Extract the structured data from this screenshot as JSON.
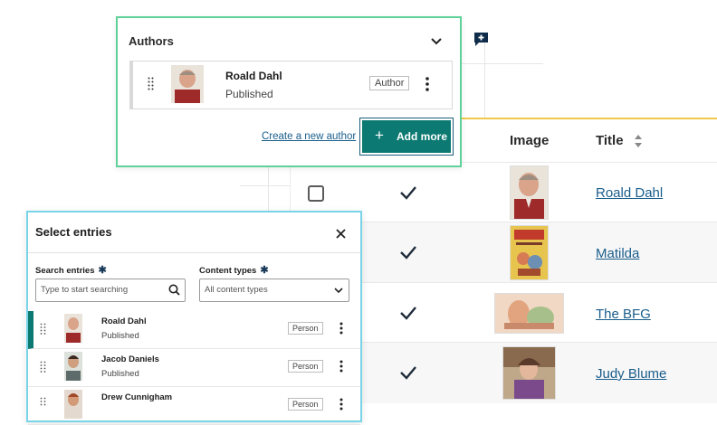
{
  "table": {
    "headers": {
      "image": "Image",
      "title": "Title"
    },
    "rows": [
      {
        "title": "Roald Dahl",
        "checked": true,
        "image": "roald-dahl-photo"
      },
      {
        "title": "Matilda",
        "checked": true,
        "image": "matilda-book-cover"
      },
      {
        "title": "The BFG",
        "checked": true,
        "image": "bfg-illustration"
      },
      {
        "title": "Judy Blume",
        "checked": true,
        "image": "judy-blume-photo"
      }
    ]
  },
  "authors": {
    "title": "Authors",
    "item": {
      "name": "Roald Dahl",
      "status": "Published",
      "tag": "Author"
    },
    "create_link": "Create a new author",
    "add_more": "Add more"
  },
  "select_entries": {
    "title": "Select entries",
    "search_label": "Search entries",
    "search_placeholder": "Type to start searching",
    "types_label": "Content types",
    "types_value": "All content types",
    "entries": [
      {
        "name": "Roald Dahl",
        "status": "Published",
        "tag": "Person"
      },
      {
        "name": "Jacob Daniels",
        "status": "Published",
        "tag": "Person"
      },
      {
        "name": "Drew Cunnigham",
        "status": "",
        "tag": "Person"
      }
    ]
  },
  "colors": {
    "accent": "#0c7a72",
    "authors_border": "#5fd29a",
    "panel_border": "#7ad4e8",
    "link": "#1a5d8c",
    "gold": "#f0c94a"
  }
}
